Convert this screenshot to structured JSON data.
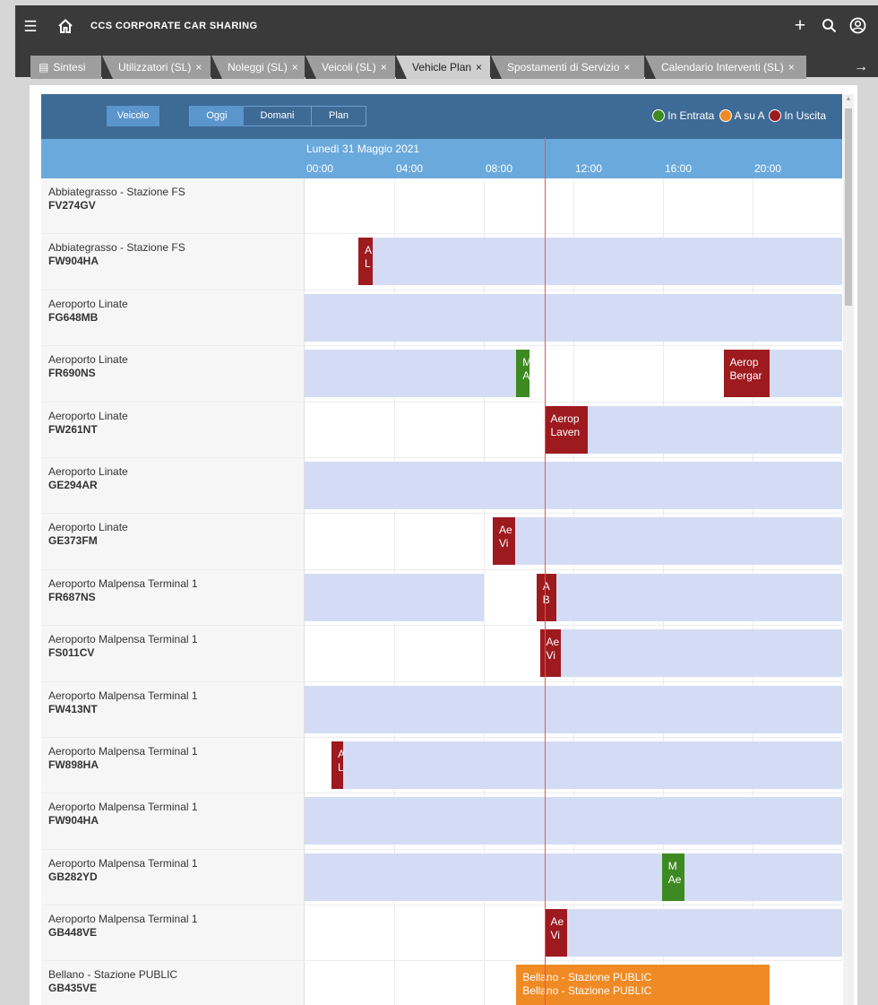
{
  "topbar": {
    "menu_icon": "hamburger-menu-icon",
    "home_icon": "home-icon",
    "title": "CCS CORPORATE CAR SHARING",
    "add_icon": "plus-icon",
    "search_icon": "search-icon",
    "user_icon": "user-account-icon"
  },
  "tabs": [
    {
      "label": "Sintesi",
      "icon": "document-icon",
      "closable": false,
      "active": false
    },
    {
      "label": "Utilizzatori (SL)",
      "close": "×",
      "closable": true,
      "active": false
    },
    {
      "label": "Noleggi (SL)",
      "close": "×",
      "closable": true,
      "active": false
    },
    {
      "label": "Veicoli (SL)",
      "close": "×",
      "closable": true,
      "active": false
    },
    {
      "label": "Vehicle Plan",
      "close": "×",
      "closable": true,
      "active": true
    },
    {
      "label": "Spostamenti di Servizio",
      "close": "×",
      "closable": true,
      "active": false
    },
    {
      "label": "Calendario Interventi (SL)",
      "close": "×",
      "closable": true,
      "active": false
    }
  ],
  "tabs_next_icon": "arrow-right-icon",
  "header": {
    "vehicle_button": "Veicolo",
    "day_buttons": [
      "Oggi",
      "Domani",
      "Plan"
    ],
    "legend": [
      {
        "label": "In Entrata",
        "color": "#3c8a21"
      },
      {
        "label": "A su A",
        "color": "#f08a24"
      },
      {
        "label": "In Uscita",
        "color": "#9d1a1f"
      }
    ]
  },
  "timeline": {
    "date": "Lunedì 31 Maggio 2021",
    "ticks": [
      "00:00",
      "04:00",
      "08:00",
      "12:00",
      "16:00",
      "20:00"
    ],
    "hour_start": 0,
    "hour_end": 24,
    "now_hour": 10.7
  },
  "colors": {
    "header": "#3e6a96",
    "date_header": "#6aa9dc",
    "availability": "#d4dcf5",
    "in_uscita": "#9d1a1f",
    "in_entrata": "#3c8a21",
    "a_su_a": "#f08a24",
    "now_line": "#e8554e"
  },
  "rows": [
    {
      "location": "Abbiategrasso - Stazione FS",
      "plate": "FV274GV",
      "available": [],
      "bookings": []
    },
    {
      "location": "Abbiategrasso - Stazione FS",
      "plate": "FW904HA",
      "available": [
        [
          3.05,
          24
        ]
      ],
      "bookings": [
        {
          "type": "uscita",
          "start": 2.4,
          "end": 3.05,
          "lines": [
            "A",
            "L"
          ]
        }
      ]
    },
    {
      "location": "Aeroporto Linate",
      "plate": "FG648MB",
      "available": [
        [
          0,
          24
        ]
      ],
      "bookings": []
    },
    {
      "location": "Aeroporto Linate",
      "plate": "FR690NS",
      "available": [
        [
          0,
          9.45
        ],
        [
          20.75,
          24
        ]
      ],
      "bookings": [
        {
          "type": "entrata",
          "start": 9.45,
          "end": 10.05,
          "lines": [
            "M",
            "A"
          ]
        },
        {
          "type": "uscita",
          "start": 18.7,
          "end": 20.75,
          "lines": [
            "Aerop",
            "Bergar"
          ]
        }
      ]
    },
    {
      "location": "Aeroporto Linate",
      "plate": "FW261NT",
      "available": [
        [
          12.65,
          24
        ]
      ],
      "bookings": [
        {
          "type": "uscita",
          "start": 10.7,
          "end": 12.65,
          "lines": [
            "Aerop",
            "Laven"
          ]
        }
      ]
    },
    {
      "location": "Aeroporto Linate",
      "plate": "GE294AR",
      "available": [
        [
          0,
          24
        ]
      ],
      "bookings": []
    },
    {
      "location": "Aeroporto Linate",
      "plate": "GE373FM",
      "available": [
        [
          9.4,
          24
        ]
      ],
      "bookings": [
        {
          "type": "uscita",
          "start": 8.4,
          "end": 9.4,
          "lines": [
            "Ae",
            "Vi"
          ]
        }
      ]
    },
    {
      "location": "Aeroporto Malpensa Terminal 1",
      "plate": "FR687NS",
      "available": [
        [
          0,
          8.0
        ],
        [
          11.25,
          24
        ]
      ],
      "bookings": [
        {
          "type": "uscita",
          "start": 10.35,
          "end": 11.25,
          "lines": [
            "A",
            "B"
          ]
        }
      ]
    },
    {
      "location": "Aeroporto Malpensa Terminal 1",
      "plate": "FS011CV",
      "available": [
        [
          11.45,
          24
        ]
      ],
      "bookings": [
        {
          "type": "uscita",
          "start": 10.5,
          "end": 11.45,
          "lines": [
            "Ae",
            "Vi"
          ]
        }
      ]
    },
    {
      "location": "Aeroporto Malpensa Terminal 1",
      "plate": "FW413NT",
      "available": [
        [
          0,
          24
        ]
      ],
      "bookings": []
    },
    {
      "location": "Aeroporto Malpensa Terminal 1",
      "plate": "FW898HA",
      "available": [
        [
          1.7,
          24
        ]
      ],
      "bookings": [
        {
          "type": "uscita",
          "start": 1.2,
          "end": 1.7,
          "lines": [
            "A",
            "L"
          ]
        }
      ]
    },
    {
      "location": "Aeroporto Malpensa Terminal 1",
      "plate": "FW904HA",
      "available": [
        [
          0,
          24
        ]
      ],
      "bookings": []
    },
    {
      "location": "Aeroporto Malpensa Terminal 1",
      "plate": "GB282YD",
      "available": [
        [
          0,
          15.95
        ],
        [
          16.95,
          24
        ]
      ],
      "bookings": [
        {
          "type": "entrata",
          "start": 15.95,
          "end": 16.95,
          "lines": [
            "M",
            "Ae"
          ]
        }
      ]
    },
    {
      "location": "Aeroporto Malpensa Terminal 1",
      "plate": "GB448VE",
      "available": [
        [
          11.7,
          24
        ]
      ],
      "bookings": [
        {
          "type": "uscita",
          "start": 10.7,
          "end": 11.7,
          "lines": [
            "Ae",
            "Vi"
          ]
        }
      ]
    },
    {
      "location": "Bellano - Stazione PUBLIC",
      "plate": "GB435VE",
      "available": [],
      "bookings": [
        {
          "type": "asua",
          "start": 9.45,
          "end": 20.75,
          "lines": [
            "Bellano - Stazione PUBLIC",
            "Bellano - Stazione PUBLIC"
          ]
        }
      ]
    }
  ]
}
